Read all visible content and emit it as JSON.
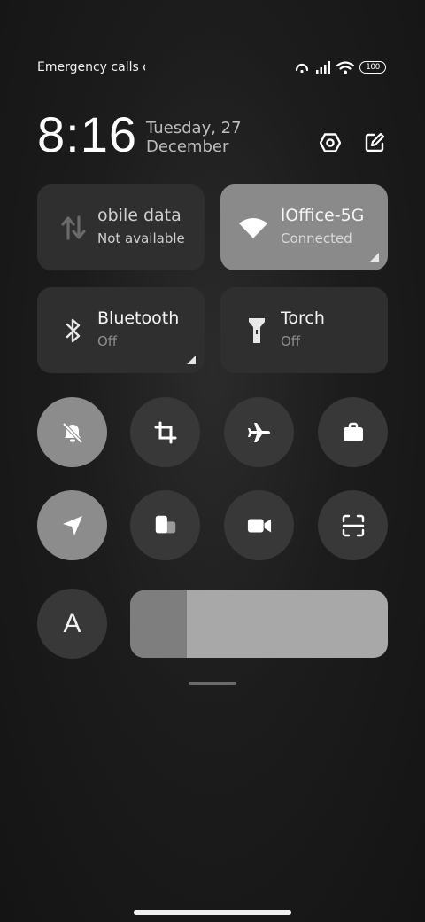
{
  "status_bar": {
    "carrier_text": "Emergency calls o",
    "battery_level": "100",
    "icons": [
      "hotspot-icon",
      "signal-icon",
      "wifi-icon",
      "battery-icon"
    ]
  },
  "header": {
    "time": "8:16",
    "date": "Tuesday, 27 December",
    "actions": [
      "settings-icon",
      "edit-icon"
    ]
  },
  "tiles": {
    "mobile_data": {
      "title": "obile data",
      "subtitle": "Not available"
    },
    "wifi": {
      "title": "lOffice-5G",
      "subtitle": "Connected"
    },
    "bluetooth": {
      "title": "Bluetooth",
      "subtitle": "Off"
    },
    "torch": {
      "title": "Torch",
      "subtitle": "Off"
    }
  },
  "toggles_row1": [
    "silent-bell-icon",
    "crop-icon",
    "airplane-icon",
    "briefcase-icon"
  ],
  "toggles_row2": [
    "location-icon",
    "screen-cast-icon",
    "video-camera-icon",
    "scan-icon"
  ],
  "font_button": {
    "label": "A"
  },
  "brightness": {
    "level": 0.22
  },
  "colors": {
    "tile_dark": "#2f2f2f",
    "tile_active": "#8a8a8a",
    "circle_dark": "#383838",
    "circle_active": "#8c8c8c"
  }
}
